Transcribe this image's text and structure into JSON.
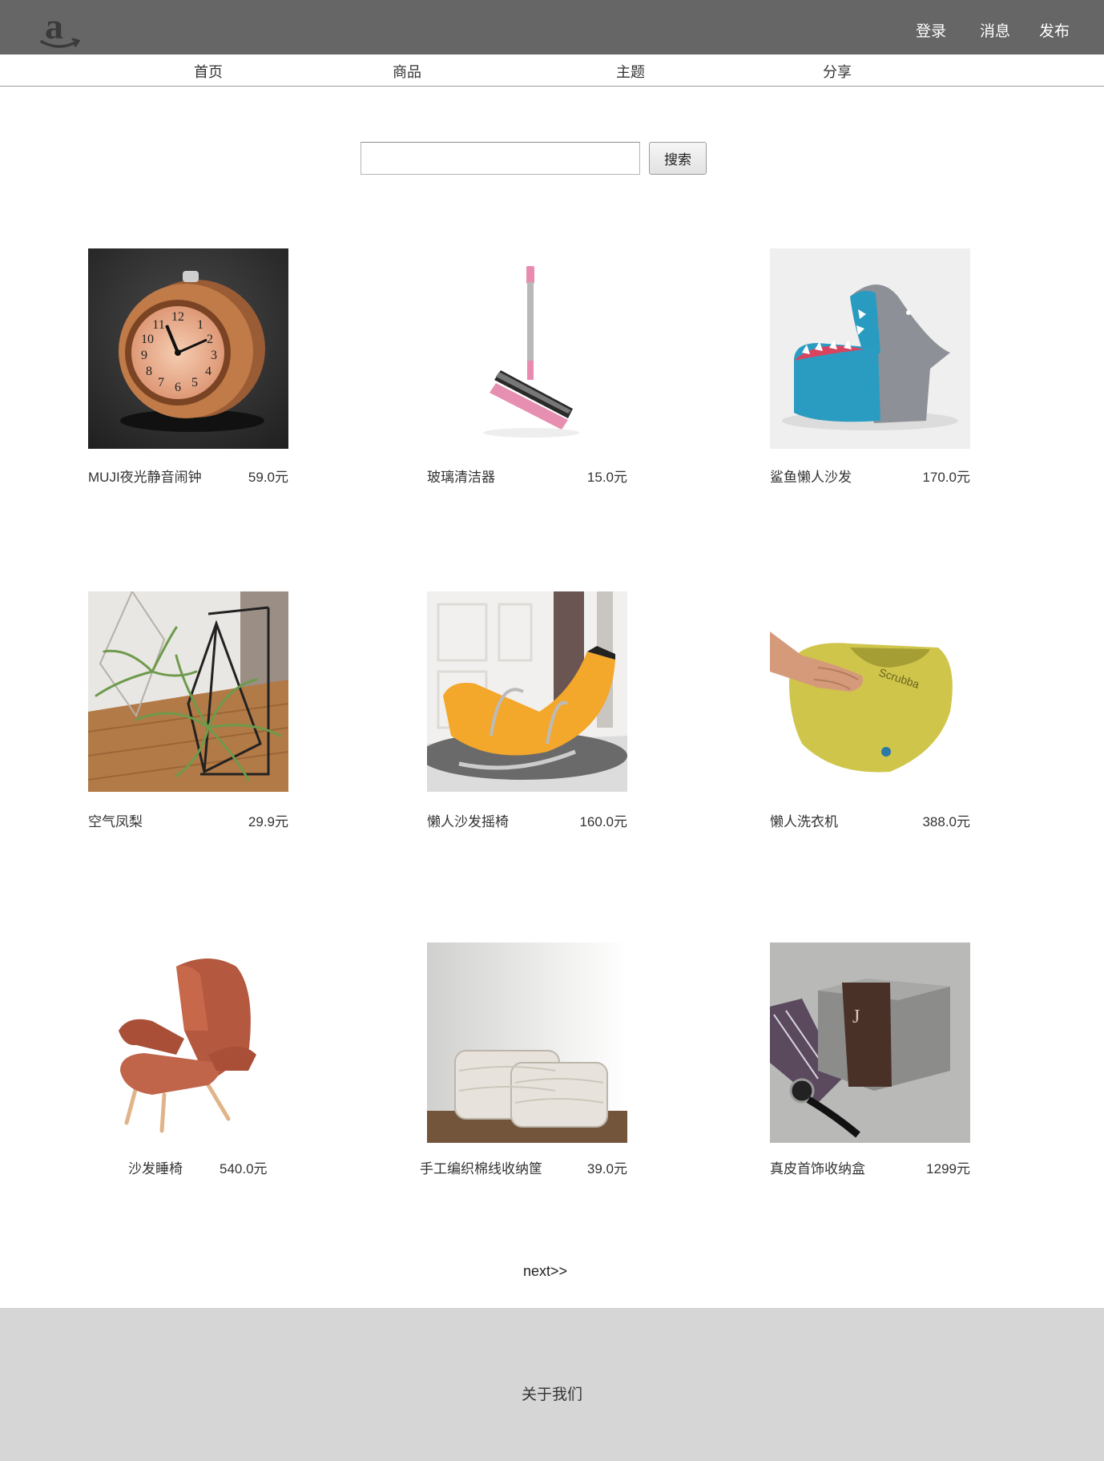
{
  "header": {
    "logo": "amazon-logo-icon",
    "links": {
      "login": "登录",
      "messages": "消息",
      "publish": "发布"
    }
  },
  "nav": {
    "items": [
      "首页",
      "商品",
      "主题",
      "分享"
    ]
  },
  "search": {
    "value": "",
    "placeholder": "",
    "button_label": "搜索"
  },
  "products": [
    {
      "name": "MUJI夜光静音闹钟",
      "price": "59.0元",
      "image": "alarm-clock"
    },
    {
      "name": "玻璃清洁器",
      "price": "15.0元",
      "image": "window-squeegee"
    },
    {
      "name": "鲨鱼懒人沙发",
      "price": "170.0元",
      "image": "shark-beanbag"
    },
    {
      "name": "空气凤梨",
      "price": "29.9元",
      "image": "air-plant"
    },
    {
      "name": "懒人沙发摇椅",
      "price": "160.0元",
      "image": "banana-rocking-chair"
    },
    {
      "name": "懒人洗衣机",
      "price": "388.0元",
      "image": "scrubba-wash-bag"
    },
    {
      "name": "沙发睡椅",
      "price": "540.0元",
      "image": "leather-armchair"
    },
    {
      "name": "手工编织棉线收纳筐",
      "price": "39.0元",
      "image": "woven-baskets"
    },
    {
      "name": "真皮首饰收纳盒",
      "price": "1299元",
      "image": "jewelry-box"
    }
  ],
  "pagination": {
    "next_label": "next>>"
  },
  "footer": {
    "about_label": "关于我们"
  },
  "colors": {
    "topbar": "#666666",
    "footer": "#d6d6d6"
  }
}
